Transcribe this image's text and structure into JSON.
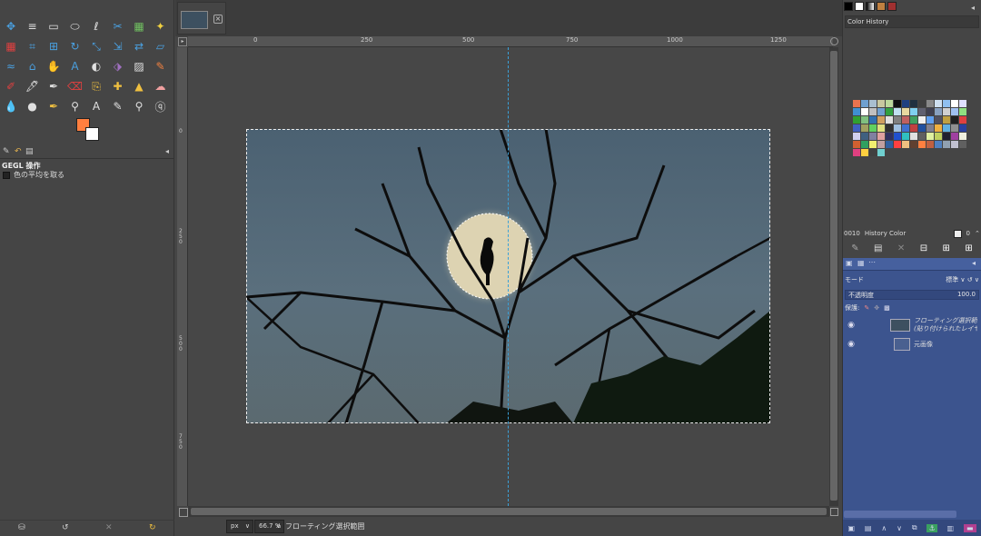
{
  "toolbox": {
    "tools": [
      "move-tool",
      "align-tool",
      "rect-select-tool",
      "ellipse-select-tool",
      "free-select-tool",
      "scissors-select-tool",
      "foreground-select-tool",
      "fuzzy-select-tool",
      "color-select-tool",
      "crop-tool",
      "unified-transform-tool",
      "rotate-tool",
      "scale-tool",
      "shear-tool",
      "flip-tool",
      "perspective-tool",
      "warp-tool",
      "cage-tool",
      "handle-transform-tool",
      "text-tool",
      "gradient-tool",
      "bucket-fill-tool",
      "paintbrush-tool",
      "pencil-tool",
      "airbrush-tool",
      "ink-tool",
      "mypaint-brush-tool",
      "eraser-tool",
      "clone-tool",
      "heal-tool",
      "perspective-clone-tool",
      "smudge-tool",
      "blur-tool",
      "dodge-burn-tool",
      "color-picker-tool",
      "measure-tool",
      "zoom-tool",
      "paths-tool",
      "text-a-tool",
      "fuzzy-tool"
    ],
    "fg_color": "#ff7f3f",
    "bg_color": "#ffffff"
  },
  "tool_options": {
    "title": "GEGL 操作",
    "option_label": "色の平均を取る"
  },
  "canvas": {
    "ruler_top": [
      "0",
      "250",
      "500",
      "750",
      "1000",
      "1250"
    ],
    "ruler_left": [
      "0",
      "2\n5\n0",
      "5\n0\n0",
      "7\n5\n0"
    ],
    "unit": "px",
    "zoom": "66.7 %",
    "status": "フローティング選択範囲"
  },
  "color_history": {
    "title": "Color History",
    "history_label": "History Color",
    "hex_prefix": "0010",
    "value": "0",
    "swatches": [
      "#e8734f",
      "#6fa0d0",
      "#a9bfd0",
      "#c8c8a0",
      "#bcd89c",
      "#101010",
      "#204080",
      "#203040",
      "#3f3f3f",
      "#888888",
      "#cfe0f0",
      "#90c0f0",
      "#ffffff",
      "#e0e0ff",
      "#3f8fd0",
      "#ffffff",
      "#c0c0c0",
      "#70a0d0",
      "#30a040",
      "#c0e0f0",
      "#e8d8a0",
      "#80d0f0",
      "#606070",
      "#404050",
      "#88a0c0",
      "#d0d0d0",
      "#a0c0f0",
      "#90e080",
      "#30a030",
      "#80c080",
      "#3070b0",
      "#d0a060",
      "#e0e0e0",
      "#808080",
      "#c06060",
      "#40a060",
      "#f0f0f0",
      "#60a0f0",
      "#505060",
      "#c0a040",
      "#202020",
      "#e04040",
      "#4060c0",
      "#a0a060",
      "#60d060",
      "#e0e080",
      "#303030",
      "#a0c0e0",
      "#4070d0",
      "#c04040",
      "#2050a0",
      "#808090",
      "#f0b040",
      "#60b0e0",
      "#909090",
      "#2a40a0",
      "#d0d0f0",
      "#406080",
      "#8080a0",
      "#e0a0a0",
      "#303060",
      "#2050d0",
      "#30c0c0",
      "#e0e0e0",
      "#606060",
      "#e0f0a0",
      "#c0d060",
      "#202030",
      "#a040a0",
      "#f0f0e0",
      "#d06030",
      "#30a060",
      "#f0f070",
      "#c0a0a0",
      "#3060a0",
      "#ff4040",
      "#f0c080",
      "#604030",
      "#ff8040",
      "#c06040",
      "#5080c0",
      "#90a0b0",
      "#c0c0d0",
      "#606060",
      "#e04080",
      "#ffd040",
      "#404040",
      "#70d0d0"
    ]
  },
  "layers": {
    "mode_label": "モード",
    "mode_value": "標準",
    "opacity_label": "不透明度",
    "opacity_value": "100.0",
    "lock_label": "保護:",
    "items": [
      {
        "name": "フローティング選択範囲",
        "sub": "(貼り付けられたレイヤー)"
      },
      {
        "name": "元画像",
        "sub": ""
      }
    ]
  }
}
